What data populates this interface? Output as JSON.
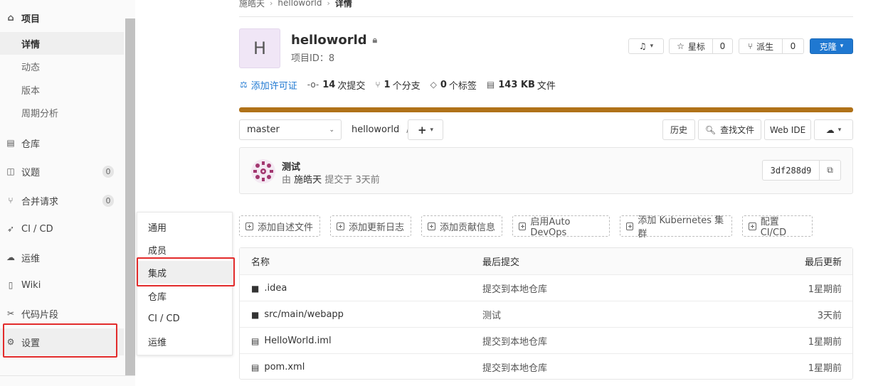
{
  "breadcrumb": {
    "owner": "施皓天",
    "project": "helloworld",
    "current": "详情"
  },
  "sidebar": {
    "project_label": "项目",
    "sub_items": [
      "详情",
      "动态",
      "版本",
      "周期分析"
    ],
    "items": [
      {
        "label": "仓库",
        "icon": "doc-icon"
      },
      {
        "label": "议题",
        "icon": "issues-icon",
        "badge": "0"
      },
      {
        "label": "合并请求",
        "icon": "merge-request-icon",
        "badge": "0"
      },
      {
        "label": "CI / CD",
        "icon": "rocket-icon"
      },
      {
        "label": "运维",
        "icon": "cloud-gear-icon"
      },
      {
        "label": "Wiki",
        "icon": "book-icon"
      },
      {
        "label": "代码片段",
        "icon": "scissors-icon"
      },
      {
        "label": "设置",
        "icon": "gear-icon"
      }
    ]
  },
  "flyout": {
    "items": [
      "通用",
      "成员",
      "集成",
      "仓库",
      "CI / CD",
      "运维"
    ]
  },
  "project": {
    "avatar_letter": "H",
    "name": "helloworld",
    "id_label": "项目ID：8"
  },
  "actions": {
    "star_label": "星标",
    "star_count": "0",
    "fork_label": "派生",
    "fork_count": "0",
    "clone_label": "克隆"
  },
  "stats": {
    "license": "添加许可证",
    "commits_num": "14",
    "commits_label": "次提交",
    "branches_num": "1",
    "branches_label": "个分支",
    "tags_num": "0",
    "tags_label": "个标签",
    "files_size": "143 KB",
    "files_label": "文件"
  },
  "toolbar": {
    "branch": "master",
    "path": "helloworld",
    "slash": "/",
    "plus": "+",
    "history": "历史",
    "find_file": "查找文件",
    "web_ide": "Web IDE"
  },
  "last_commit": {
    "title": "测试",
    "by": "由",
    "author": "施皓天",
    "submitted": "提交于 3天前",
    "sha": "3df288d9"
  },
  "quick_actions": [
    "添加自述文件",
    "添加更新日志",
    "添加贡献信息",
    "启用Auto DevOps",
    "添加 Kubernetes 集群",
    "配置 CI/CD"
  ],
  "table": {
    "headers": {
      "name": "名称",
      "last_commit": "最后提交",
      "last_update": "最后更新"
    },
    "rows": [
      {
        "name": ".idea",
        "type": "folder",
        "commit": "提交到本地仓库",
        "updated": "1星期前"
      },
      {
        "name": "src/main/webapp",
        "type": "folder",
        "commit": "测试",
        "updated": "3天前"
      },
      {
        "name": "HelloWorld.iml",
        "type": "file",
        "commit": "提交到本地仓库",
        "updated": "1星期前"
      },
      {
        "name": "pom.xml",
        "type": "file",
        "commit": "提交到本地仓库",
        "updated": "1星期前"
      }
    ]
  },
  "colors": {
    "accent": "#1f78d1",
    "highlight": "#e22b2b",
    "language_bar": "#b07219"
  }
}
